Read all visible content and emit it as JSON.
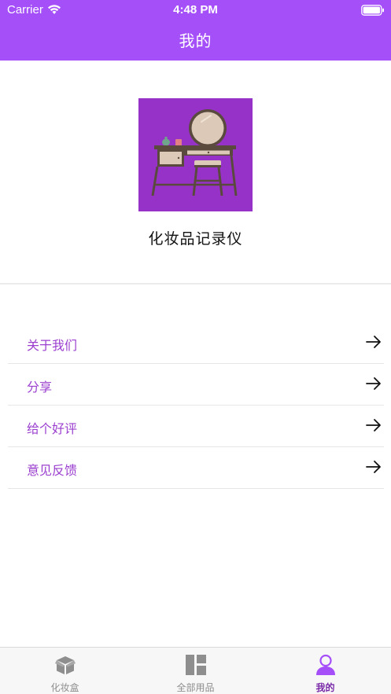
{
  "status_bar": {
    "carrier": "Carrier",
    "time": "4:48 PM"
  },
  "nav": {
    "title": "我的"
  },
  "profile": {
    "app_name": "化妆品记录仪",
    "logo_icon": "vanity-table-icon"
  },
  "menu": {
    "items": [
      {
        "label": "关于我们",
        "icon": "arrow-right-icon"
      },
      {
        "label": "分享",
        "icon": "arrow-right-icon"
      },
      {
        "label": "给个好评",
        "icon": "arrow-right-icon"
      },
      {
        "label": "意见反馈",
        "icon": "arrow-right-icon"
      }
    ]
  },
  "tabbar": {
    "tabs": [
      {
        "label": "化妆盒",
        "icon": "box-icon",
        "active": false
      },
      {
        "label": "全部用品",
        "icon": "grid-icon",
        "active": false
      },
      {
        "label": "我的",
        "icon": "person-icon",
        "active": true
      }
    ]
  },
  "colors": {
    "accent": "#a54ff9",
    "menu_text": "#9b3fcf",
    "logo_bg": "#9632c7",
    "active_tab": "#7a2aa8",
    "inactive_tab": "#8e8e8e"
  }
}
